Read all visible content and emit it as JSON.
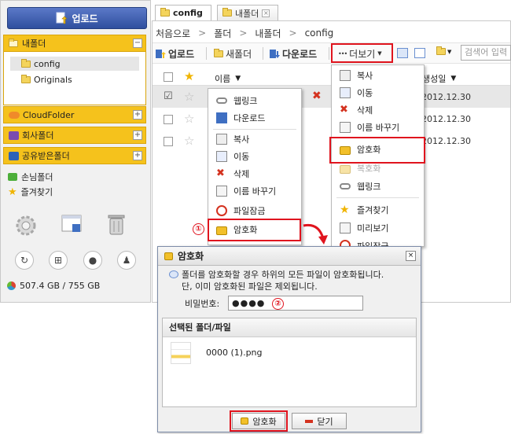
{
  "sidebar": {
    "upload_label": "업로드",
    "my_folder": "내폴더",
    "tree": [
      "config",
      "Originals"
    ],
    "cloud_folder": "CloudFolder",
    "company_folder": "회사폴더",
    "shared_folder": "공유받은폴더",
    "guest_folder": "손님폴더",
    "favorites": "즐겨찾기",
    "minus": "−",
    "plus": "+",
    "storage": "507.4 GB / 755 GB"
  },
  "tabs": [
    {
      "label": "config"
    },
    {
      "label": "내폴더"
    }
  ],
  "tab_close": "×",
  "breadcrumb": [
    "처음으로",
    "폴더",
    "내폴더",
    "config"
  ],
  "breadcrumb_sep": ">",
  "toolbar": {
    "upload": "업로드",
    "new_folder": "새폴더",
    "download": "다운로드",
    "more": "더보기",
    "more_dots": "•••",
    "search_placeholder": "검색어 입력"
  },
  "list": {
    "name_header": "이름",
    "date_header_partial": "생성일",
    "dates": [
      "2012.12.30",
      "2012.12.30",
      "2012.12.30"
    ]
  },
  "context_menu": {
    "items": [
      "웹링크",
      "다운로드",
      "복사",
      "이동",
      "삭제",
      "이름 바꾸기",
      "파일잠금",
      "암호화"
    ]
  },
  "more_menu": {
    "items": [
      "복사",
      "이동",
      "삭제",
      "이름 바꾸기",
      "암호화",
      "복호화",
      "웹링크",
      "즐겨찾기",
      "미리보기",
      "파일잠금"
    ]
  },
  "callouts": {
    "step1": "①",
    "step2": "②"
  },
  "dialog": {
    "title": "암호화",
    "close": "×",
    "message_line1": "폴더를 암호화할 경우 하위의 모든 파일이 암호화됩니다.",
    "message_line2": "단, 이미 암호화된 파일은 제외됩니다.",
    "password_label": "비밀번호:",
    "password_value": "●●●●",
    "selected_header": "선택된 폴더/파일",
    "selected_file": "0000 (1).png",
    "encrypt_button": "암호화",
    "close_button": "닫기"
  },
  "colors": {
    "accent_red": "#e0141e",
    "sidebar_yellow": "#f5c21c",
    "upload_blue": "#2f4f9e"
  }
}
